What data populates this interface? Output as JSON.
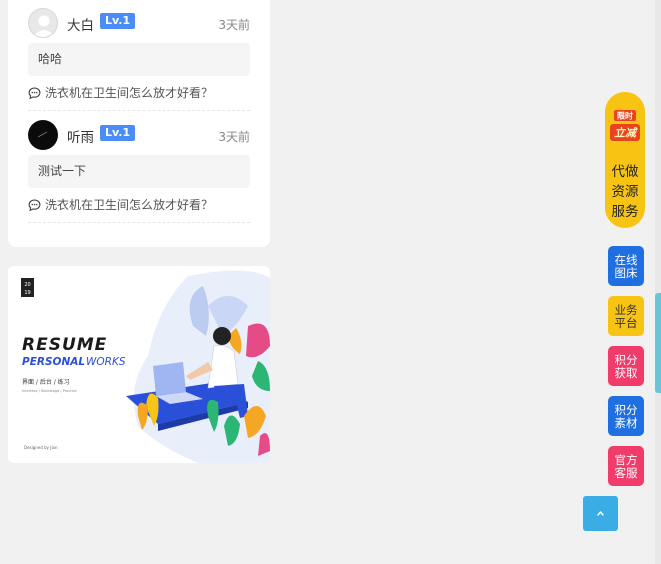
{
  "comments": [
    {
      "user": "大白",
      "level": "Lv.1",
      "time": "3天前",
      "text": "哈哈",
      "topic": "洗衣机在卫生间怎么放才好看？"
    },
    {
      "user": "听雨",
      "level": "Lv.1",
      "time": "3天前",
      "text": "测试一下",
      "topic": "洗衣机在卫生间怎么放才好看？"
    }
  ],
  "banner": {
    "year_top": "20",
    "year_bottom": "19",
    "title": "RESUME",
    "subtitle_a": "PERSONAL",
    "subtitle_b": "WORKS",
    "tagline": "界面 / 后台 / 练习",
    "tagline_sub": "Interface / Backstage / Practice",
    "credit": "Designed by Jian"
  },
  "sidebar": {
    "promo_line1": "限时",
    "promo_line2": "立减",
    "service": [
      "代做",
      "资源",
      "服务"
    ],
    "buttons": [
      {
        "label": "在线图床",
        "color": "#1f6fe0"
      },
      {
        "label": "业务平台",
        "color": "#f7c414"
      },
      {
        "label": "积分获取",
        "color": "#f03c6a"
      },
      {
        "label": "积分素材",
        "color": "#1f6fe0"
      },
      {
        "label": "官方客服",
        "color": "#f03c6a"
      }
    ]
  },
  "icons": {
    "topic": "chat-bubble-icon",
    "back_to_top": "chevron-up-icon"
  }
}
